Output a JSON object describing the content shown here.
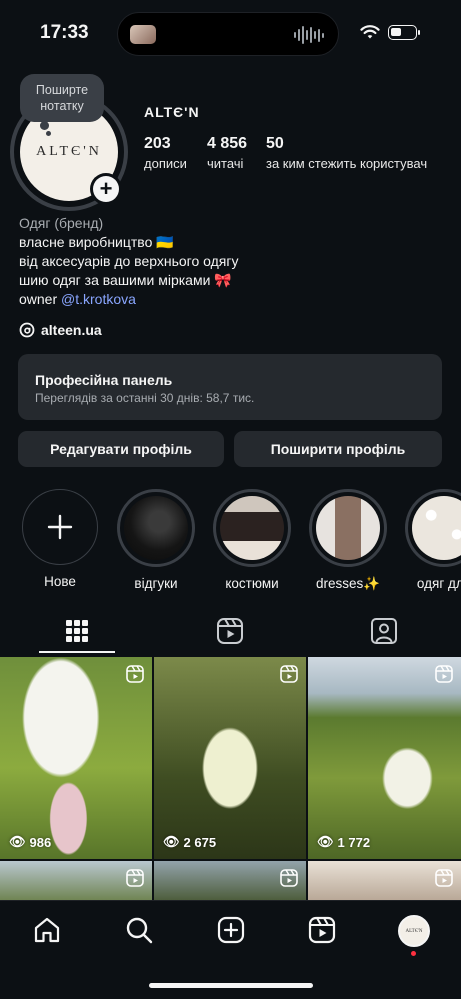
{
  "status_bar": {
    "time": "17:33"
  },
  "profile": {
    "note_text": "Поширте нотатку",
    "username": "ALTЄ'N",
    "avatar_logo": "ALTЄ'N",
    "stats": [
      {
        "value": "203",
        "label": "дописи"
      },
      {
        "value": "4 856",
        "label": "читачі"
      },
      {
        "value": "50",
        "label": "за ким стежить користувач"
      }
    ],
    "bio": {
      "category": "Одяг (бренд)",
      "lines": [
        "власне виробництво 🇺🇦",
        "від аксесуарів до верхнього одягу",
        "шию одяг за вашими мірками 🎀"
      ],
      "owner_prefix": "owner ",
      "owner_mention": "@t.krotkova"
    },
    "threads_handle": "alteen.ua"
  },
  "dashboard": {
    "title": "Професійна панель",
    "subtitle": "Переглядів за останні 30 днів: 58,7 тис."
  },
  "buttons": {
    "edit": "Редагувати профіль",
    "share": "Поширити профіль"
  },
  "highlights": [
    {
      "label": "Нове"
    },
    {
      "label": "відгуки"
    },
    {
      "label": "костюми"
    },
    {
      "label": "dresses✨"
    },
    {
      "label": "одяг для"
    }
  ],
  "posts": [
    {
      "views": "986"
    },
    {
      "views": "2 675"
    },
    {
      "views": "1 772"
    },
    {
      "views": ""
    },
    {
      "views": ""
    },
    {
      "views": ""
    }
  ],
  "colors": {
    "background": "#0c1014",
    "surface": "#25292e",
    "mention": "#8aa6ff",
    "notification": "#ff3040"
  }
}
